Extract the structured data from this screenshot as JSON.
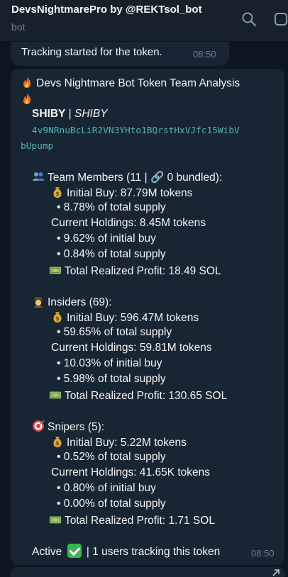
{
  "header": {
    "title": "DevsNightmarePro by @REKTsol_bot",
    "subtitle": "bot",
    "icons": [
      "search-icon",
      "more-options-icon"
    ]
  },
  "messages": {
    "tracking": {
      "text": "Tracking started for the token.",
      "time": "08:50"
    },
    "analysis": {
      "title": "Devs Nightmare Bot Token Team Analysis",
      "token_symbol": "SHIBY",
      "separator": " | ",
      "token_name": "SHIBY",
      "address_line1": "4v9NRnuBcLiR2VN3YHto1BQrstHxVJfc15WibV",
      "address_line2": "bUpump",
      "team": {
        "heading": "Team Members (11 | 🔗 0 bundled):",
        "initial_buy": "Initial Buy: 87.79M tokens",
        "initial_supply": "• 8.78% of total supply",
        "current_holdings": "Current Holdings: 8.45M tokens",
        "pct_initial": "• 9.62% of initial buy",
        "pct_supply": "• 0.84% of total supply",
        "profit": "Total Realized Profit: 18.49 SOL"
      },
      "insiders": {
        "heading": "Insiders (69):",
        "initial_buy": "Initial Buy: 596.47M tokens",
        "initial_supply": "• 59.65% of total supply",
        "current_holdings": "Current Holdings: 59.81M tokens",
        "pct_initial": "• 10.03% of initial buy",
        "pct_supply": "• 5.98% of total supply",
        "profit": "Total Realized Profit: 130.65 SOL"
      },
      "snipers": {
        "heading": "Snipers (5):",
        "initial_buy": "Initial Buy: 5.22M tokens",
        "initial_supply": "• 0.52% of total supply",
        "current_holdings": "Current Holdings: 41.65K tokens",
        "pct_initial": "• 0.80% of initial buy",
        "pct_supply": "• 0.00% of total supply",
        "profit": "Total Realized Profit: 1.71 SOL"
      },
      "status_active": "Active",
      "status_rest": "| 1 users tracking this token",
      "time": "08:50"
    }
  },
  "icons": {
    "fire": "fire-icon",
    "team": "busts-icon",
    "money_bag": "money-bag-icon",
    "money_bill": "dollar-bill-icon",
    "insider": "detective-icon",
    "sniper": "target-icon",
    "check": "check-mark-icon"
  },
  "colors": {
    "background": "#0e1621",
    "header": "#17212b",
    "bubble": "#182533",
    "address": "#56b3b4",
    "meta": "#6d7f8f",
    "check": "#3bb54a"
  }
}
